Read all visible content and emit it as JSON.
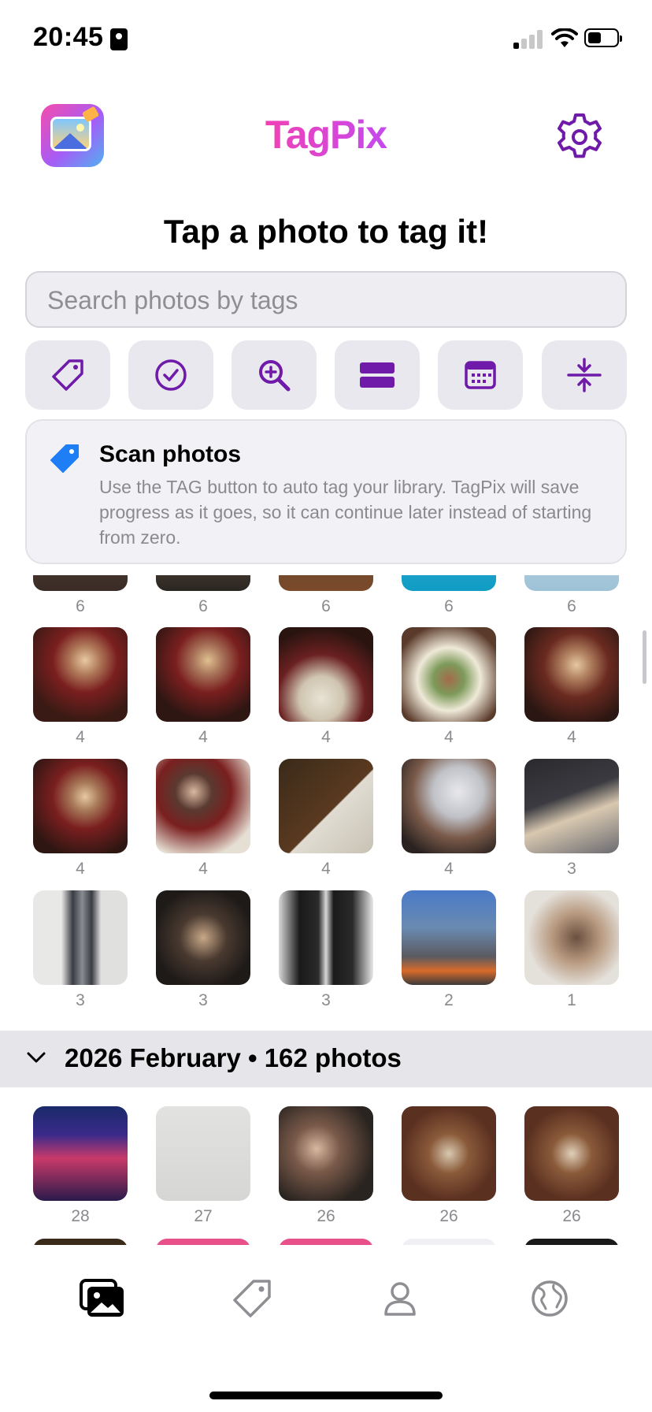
{
  "status_bar": {
    "time": "20:45"
  },
  "header": {
    "brand": "TagPix",
    "headline": "Tap a photo to tag it!"
  },
  "search": {
    "placeholder": "Search photos by tags"
  },
  "toolbar": {
    "accent_color": "#6f1aa8",
    "tools": [
      "tag-icon",
      "checkmark-circle-icon",
      "zoom-in-icon",
      "rows-icon",
      "calendar-icon",
      "compress-vertical-icon"
    ]
  },
  "info_card": {
    "title": "Scan photos",
    "body": "Use the TAG button to auto tag your library. TagPix will save progress as it goes, so it can continue later instead of starting from zero."
  },
  "grid": {
    "partial_row_counts": [
      "6",
      "6",
      "6",
      "6",
      "6"
    ],
    "rows": [
      [
        "4",
        "4",
        "4",
        "4",
        "4"
      ],
      [
        "4",
        "4",
        "4",
        "4",
        "3"
      ],
      [
        "3",
        "3",
        "3",
        "2",
        "1"
      ]
    ]
  },
  "section": {
    "label": "2026 February • 162 photos",
    "counts": [
      "28",
      "27",
      "26",
      "26",
      "26"
    ]
  },
  "tab_bar": {
    "tabs": [
      "photos-icon",
      "tag-icon",
      "person-icon",
      "globe-icon"
    ],
    "active": "photos-icon"
  }
}
